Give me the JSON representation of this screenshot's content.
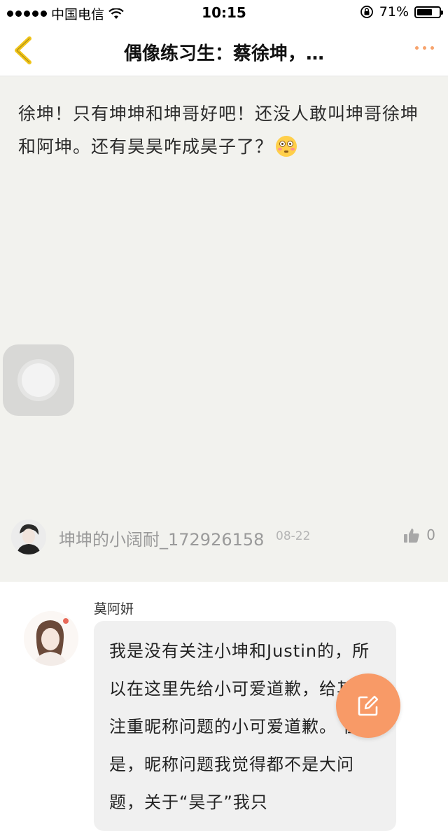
{
  "status_bar": {
    "carrier": "中国电信",
    "time": "10:15",
    "battery_percent": "71%",
    "battery_level": 0.71
  },
  "nav": {
    "title": "偶像练习生：蔡徐坤，…",
    "back_icon": "chevron-left-icon",
    "more_icon": "more-dots-icon",
    "accent_color": "#f0c419"
  },
  "post": {
    "text_before_emoji": "徐坤！只有坤坤和坤哥好吧！还没人敢叫坤哥徐坤和阿坤。还有昊昊咋成昊子了？",
    "emoji": "flushed-face-emoji",
    "author_name": "坤坤的小阔耐_172926158",
    "date": "08-22",
    "like_count": "0",
    "like_icon": "thumbs-up-icon"
  },
  "comment": {
    "author_name": "莫阿妍",
    "text": "我是没有关注小坤和Justin的，所以在这里先给小可爱道歉，给其他注重昵称问题的小可爱道歉。 但是，昵称问题我觉得都不是大问题，关于“昊子”我只"
  },
  "fab": {
    "icon": "compose-icon",
    "color": "#f89a67"
  }
}
